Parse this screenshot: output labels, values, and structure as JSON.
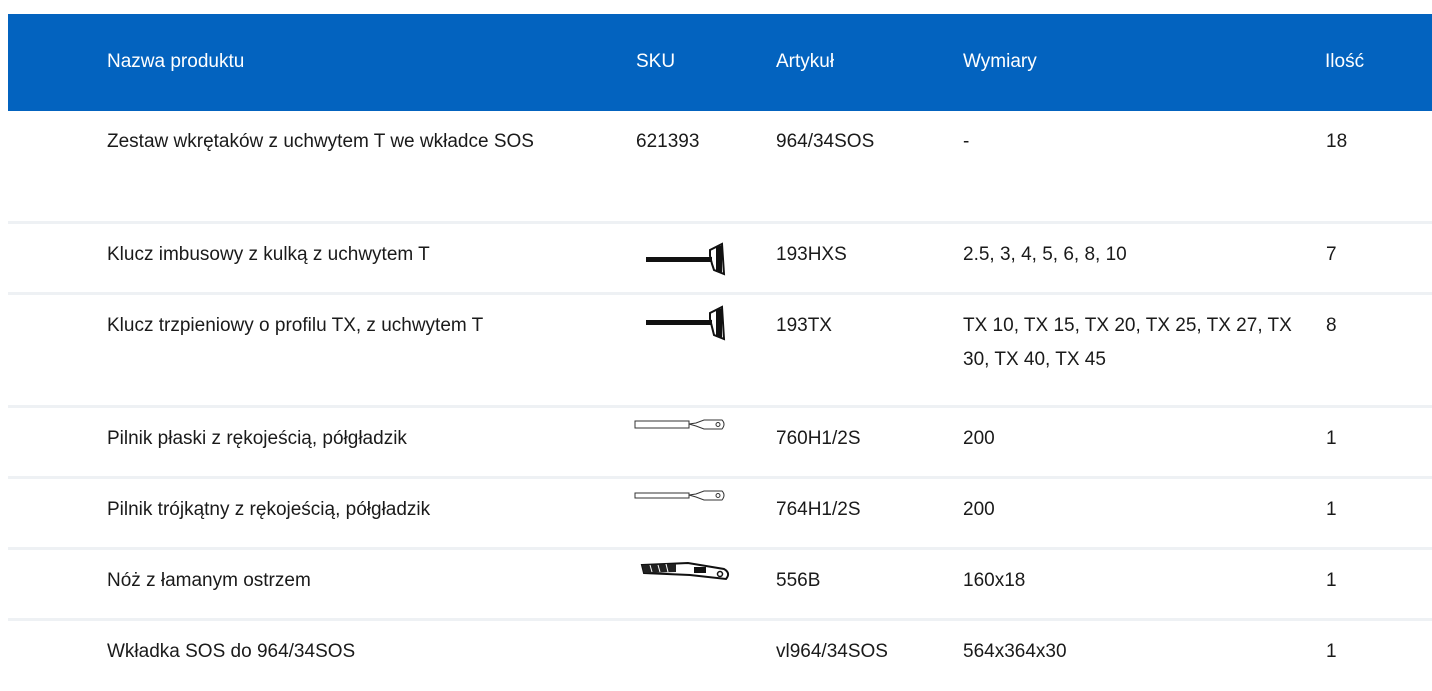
{
  "table": {
    "headers": {
      "name": "Nazwa produktu",
      "sku": "SKU",
      "article": "Artykuł",
      "dimensions": "Wymiary",
      "quantity": "Ilość"
    },
    "rows": [
      {
        "name": "Zestaw wkrętaków z uchwytem T we wkładce SOS",
        "sku": "621393",
        "sku_image": "",
        "article": "964/34SOS",
        "dimensions": "-",
        "quantity": "18"
      },
      {
        "name": "Klucz imbusowy z kulką z uchwytem T",
        "sku": "",
        "sku_image": "t-handle-hex-key-icon",
        "article": "193HXS",
        "dimensions": "2.5, 3, 4, 5, 6, 8, 10",
        "quantity": "7"
      },
      {
        "name": "Klucz trzpieniowy o profilu TX, z uchwytem T",
        "sku": "",
        "sku_image": "t-handle-torx-key-icon",
        "article": "193TX",
        "dimensions": "TX 10, TX 15, TX 20, TX 25, TX 27, TX 30, TX 40, TX 45",
        "quantity": "8"
      },
      {
        "name": "Pilnik płaski z rękojeścią, półgładzik",
        "sku": "",
        "sku_image": "flat-file-icon",
        "article": "760H1/2S",
        "dimensions": "200",
        "quantity": "1"
      },
      {
        "name": "Pilnik trójkątny z rękojeścią, półgładzik",
        "sku": "",
        "sku_image": "triangular-file-icon",
        "article": "764H1/2S",
        "dimensions": "200",
        "quantity": "1"
      },
      {
        "name": "Nóż z łamanym ostrzem",
        "sku": "",
        "sku_image": "snap-off-knife-icon",
        "article": "556B",
        "dimensions": "160x18",
        "quantity": "1"
      },
      {
        "name": "Wkładka SOS do 964/34SOS",
        "sku": "",
        "sku_image": "",
        "article": "vl964/34SOS",
        "dimensions": "564x364x30",
        "quantity": "1"
      }
    ]
  }
}
